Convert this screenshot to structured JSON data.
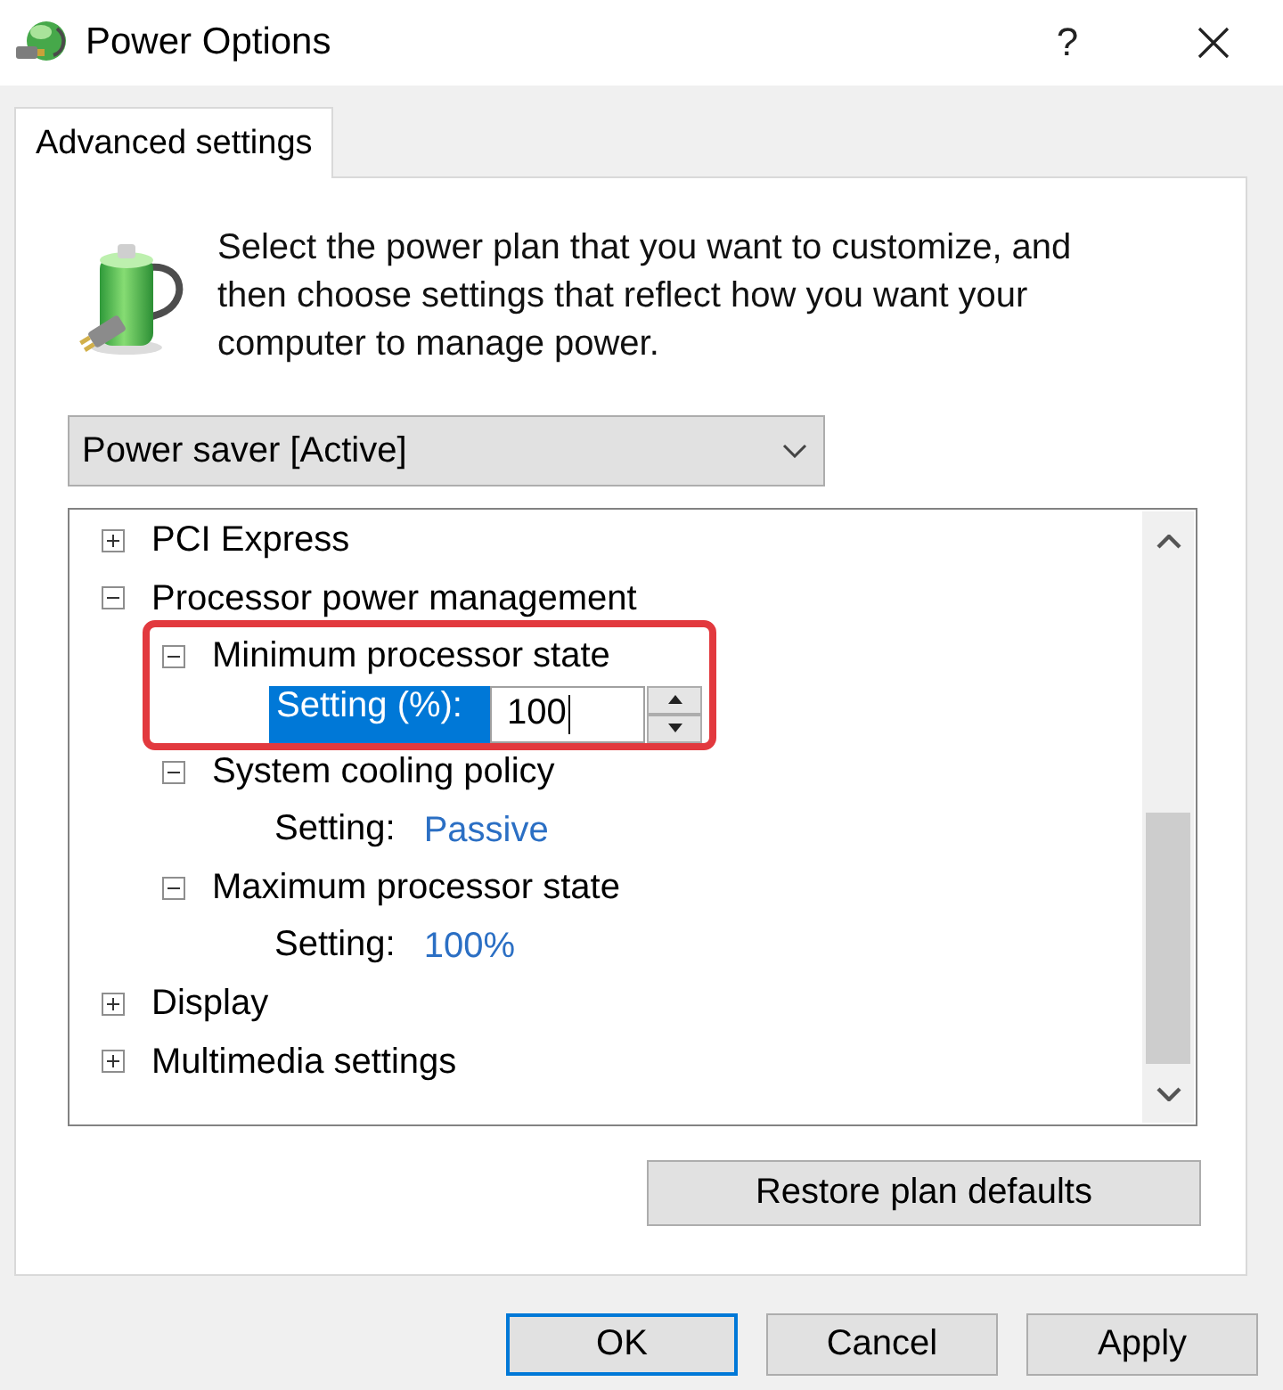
{
  "window": {
    "title": "Power Options",
    "help_button": "?"
  },
  "tabs": [
    {
      "label": "Advanced settings",
      "selected": true
    }
  ],
  "intro": {
    "text": "Select the power plan that you want to customize, and then choose settings that reflect how you want your computer to manage power."
  },
  "plan_dropdown": {
    "value": "Power saver [Active]"
  },
  "tree": {
    "items": [
      {
        "label": "PCI Express",
        "expanded": false
      },
      {
        "label": "Processor power management",
        "expanded": true,
        "children": [
          {
            "label": "Minimum processor state",
            "expanded": true,
            "highlighted": true,
            "setting": {
              "kind": "spin",
              "label": "Setting (%):",
              "value": "100",
              "selected": true
            }
          },
          {
            "label": "System cooling policy",
            "expanded": true,
            "highlighted": false,
            "setting": {
              "kind": "link",
              "label": "Setting:",
              "value": "Passive",
              "selected": false
            }
          },
          {
            "label": "Maximum processor state",
            "expanded": true,
            "highlighted": false,
            "setting": {
              "kind": "link",
              "label": "Setting:",
              "value": "100%",
              "selected": false
            }
          }
        ]
      },
      {
        "label": "Display",
        "expanded": false
      },
      {
        "label": "Multimedia settings",
        "expanded": false
      }
    ]
  },
  "restore_button": "Restore plan defaults",
  "buttons": [
    {
      "label": "OK",
      "default": true
    },
    {
      "label": "Cancel",
      "default": false
    },
    {
      "label": "Apply",
      "default": false
    }
  ]
}
